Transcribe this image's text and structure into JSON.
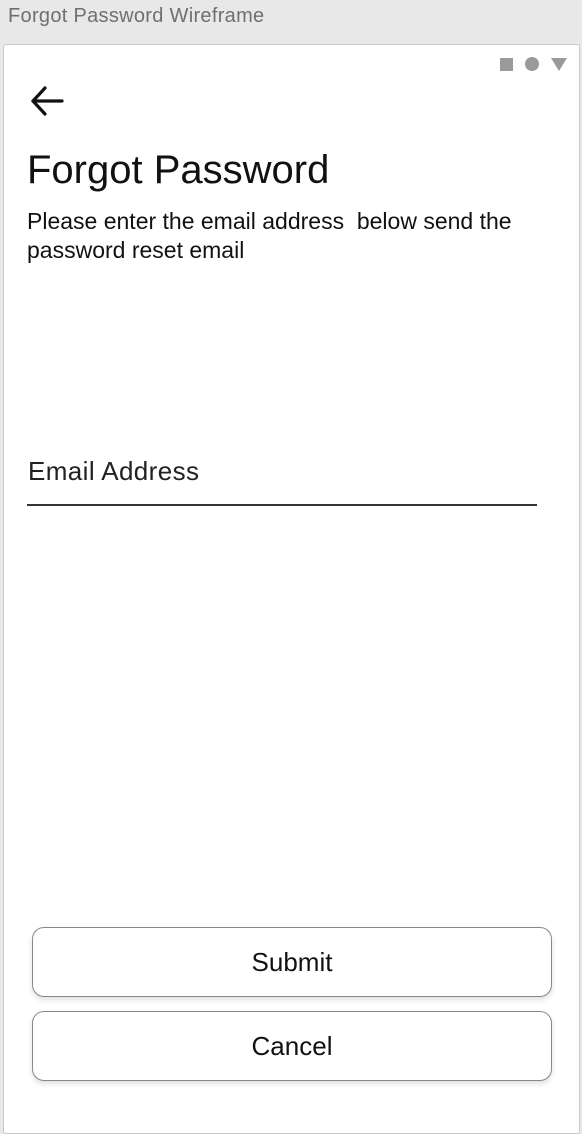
{
  "window": {
    "title": "Forgot Password Wireframe"
  },
  "status_bar": {
    "icons": [
      "square-icon",
      "circle-icon",
      "triangle-icon"
    ]
  },
  "header": {
    "back_icon": "arrow-left-icon",
    "title": "Forgot Password",
    "subtitle": "Please enter the email address  below send the password reset email"
  },
  "form": {
    "email_label": "Email Address"
  },
  "actions": {
    "submit_label": "Submit",
    "cancel_label": "Cancel"
  }
}
